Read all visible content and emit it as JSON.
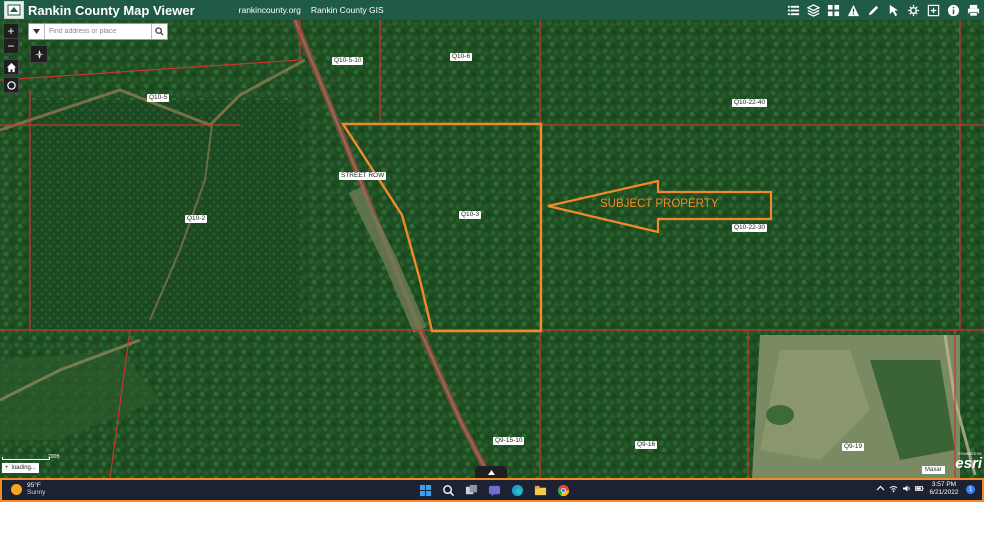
{
  "header": {
    "title": "Rankin County Map Viewer",
    "links": [
      "rankincounty.org",
      "Rankin County GIS"
    ],
    "toolbar": [
      "list-icon",
      "layers-icon",
      "basemap-grid-icon",
      "warning-icon",
      "measure-pencil-icon",
      "select-icon",
      "tools-icon",
      "expand-icon",
      "info-icon",
      "print-icon"
    ]
  },
  "search": {
    "placeholder": "Find address or place"
  },
  "map": {
    "parcel_labels": [
      "Q10-5-10",
      "Q10-6",
      "Q10-5",
      "Q10-22-40",
      "STREET ROW",
      "Q10-3",
      "Q10-2",
      "Q10-22-30",
      "Q9-15-10",
      "Q9-16",
      "Q9-19"
    ],
    "subject_label": "SUBJECT PROPERTY",
    "scale": "200ft",
    "loading": "loading...",
    "attribution": "Maxar",
    "esri_powered": "POWERED BY",
    "esri": "esri",
    "colors": {
      "parcel_line": "#c8362e",
      "subject": "#f08a2a",
      "header": "#1f5a48"
    }
  },
  "taskbar": {
    "weather": {
      "temp": "95°F",
      "condition": "Sunny"
    },
    "time": "3:57 PM",
    "date": "6/21/2022",
    "notifications": "1",
    "apps": [
      "windows-start-icon",
      "search-icon",
      "task-view-icon",
      "teams-chat-icon",
      "edge-icon",
      "file-explorer-icon",
      "chrome-icon"
    ]
  }
}
